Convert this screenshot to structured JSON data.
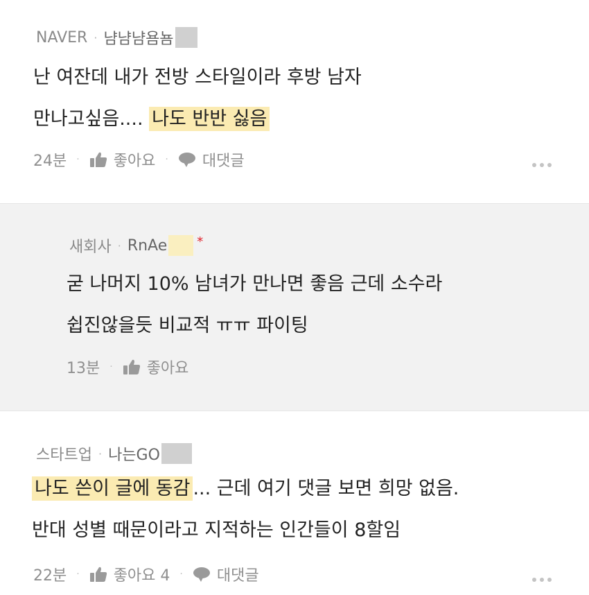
{
  "comments": [
    {
      "source": "NAVER",
      "username": "냠냠냠욤뇸",
      "lines": [
        {
          "plain": "난 여잔데 내가 전방 스타일이라 후방 남자",
          "highlight": ""
        },
        {
          "plain": "만나고싶음.... ",
          "highlight": "나도 반반 싫음"
        }
      ],
      "time": "24분",
      "like_label": "좋아요",
      "reply_label": "대댓글"
    },
    {
      "source": "새회사",
      "username": "RnAe",
      "star": "*",
      "lines": [
        {
          "plain": "굳 나머지 10% 남녀가 만나면 좋음 근데 소수라"
        },
        {
          "plain": "쉽진않을듯 비교적 ㅠㅠ 파이팅"
        }
      ],
      "time": "13분",
      "like_label": "좋아요"
    },
    {
      "source": "스타트업",
      "username": "나는GO",
      "lines": [
        {
          "highlight": "나도 쓴이 글에 동감",
          "plain": "... 근데 여기 댓글 보면 희망 없음."
        },
        {
          "plain": "반대 성별 때문이라고 지적하는 인간들이 8할임"
        }
      ],
      "time": "22분",
      "like_label": "좋아요 4",
      "reply_label": "대댓글"
    }
  ],
  "separator_dot": "·",
  "icons": {
    "like": "thumbs-up-icon",
    "reply": "speech-bubble-icon",
    "more": "more-dots-icon"
  },
  "colors": {
    "highlight": "#fbebb2",
    "reply_bg": "#f2f2f2",
    "star": "#e0202a"
  }
}
